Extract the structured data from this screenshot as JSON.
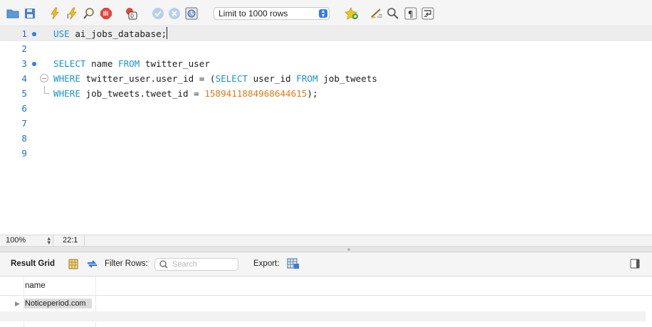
{
  "toolbar": {
    "icons": [
      "open-folder-icon",
      "save-icon",
      "execute-icon",
      "execute-current-icon",
      "explain-icon",
      "stop-icon",
      "stop-on-error-icon",
      "commit-icon",
      "rollback-icon",
      "autocommit-icon",
      "beautify-icon",
      "find-icon",
      "invisible-chars-icon",
      "wrap-icon"
    ],
    "limit_label": "Limit to 1000 rows"
  },
  "editor": {
    "lines": [
      {
        "num": "1",
        "text": "USE ai_jobs_database;"
      },
      {
        "num": "2",
        "text": ""
      },
      {
        "num": "3",
        "text": "SELECT name FROM twitter_user"
      },
      {
        "num": "4",
        "text": "WHERE twitter_user.user_id = (SELECT user_id FROM job_tweets"
      },
      {
        "num": "5",
        "text": "WHERE job_tweets.tweet_id = 1589411884968644615);"
      },
      {
        "num": "6",
        "text": ""
      },
      {
        "num": "7",
        "text": ""
      },
      {
        "num": "8",
        "text": ""
      },
      {
        "num": "9",
        "text": ""
      }
    ],
    "tokens": {
      "l1_kw": "USE",
      "l1_rest": " ai_jobs_database;",
      "l3_kw1": "SELECT",
      "l3_mid1": " name ",
      "l3_kw2": "FROM",
      "l3_rest": " twitter_user",
      "l4_kw1": "WHERE",
      "l4_mid1": " twitter_user.user_id = (",
      "l4_kw2": "SELECT",
      "l4_mid2": " user_id ",
      "l4_kw3": "FROM",
      "l4_rest": " job_tweets",
      "l5_kw1": "WHERE",
      "l5_mid1": " job_tweets.tweet_id = ",
      "l5_num": "1589411884968644615",
      "l5_rest": ");"
    }
  },
  "status": {
    "zoom": "100%",
    "cursor_position": "22:1"
  },
  "results": {
    "title": "Result Grid",
    "filter_label": "Filter Rows:",
    "search_placeholder": "Search",
    "export_label": "Export:",
    "columns": [
      "name"
    ],
    "rows": [
      [
        "Noticeperiod.com"
      ]
    ]
  },
  "colors": {
    "keyword": "#1b93c9",
    "number": "#e07a16",
    "line_number": "#1d6fd0",
    "accent": "#2f7cf6"
  }
}
